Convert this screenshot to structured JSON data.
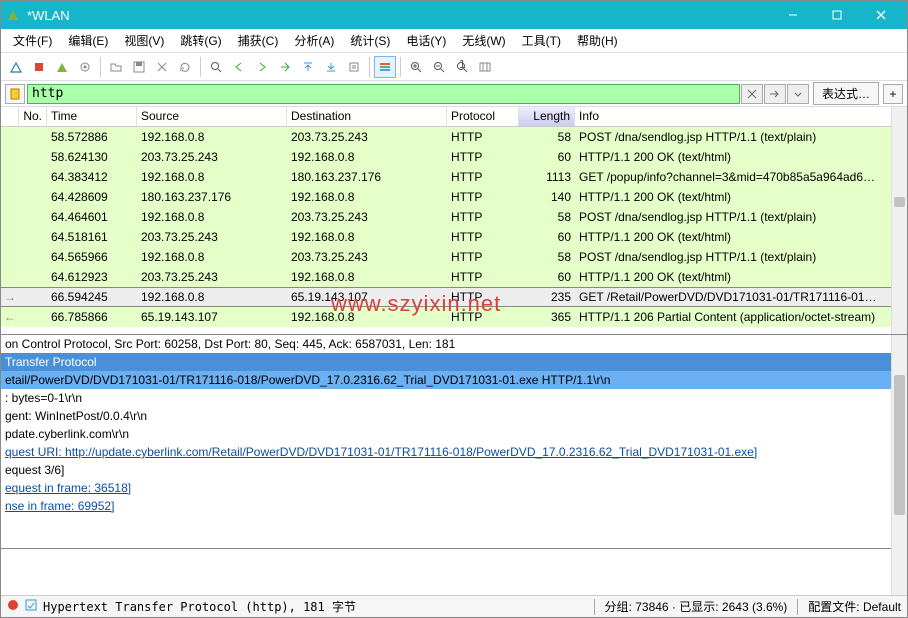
{
  "window": {
    "title": "*WLAN"
  },
  "menu": [
    "文件(F)",
    "编辑(E)",
    "视图(V)",
    "跳转(G)",
    "捕获(C)",
    "分析(A)",
    "统计(S)",
    "电话(Y)",
    "无线(W)",
    "工具(T)",
    "帮助(H)"
  ],
  "filter": {
    "value": "http",
    "expression_btn": "表达式…"
  },
  "columns": {
    "no": "No.",
    "time": "Time",
    "source": "Source",
    "dest": "Destination",
    "proto": "Protocol",
    "length": "Length",
    "info": "Info"
  },
  "packets": [
    {
      "arrow": "",
      "time": "58.572886",
      "src": "192.168.0.8",
      "dst": "203.73.25.243",
      "proto": "HTTP",
      "len": "58",
      "info": "POST /dna/sendlog.jsp HTTP/1.1  (text/plain)",
      "cls": "http"
    },
    {
      "arrow": "",
      "time": "58.624130",
      "src": "203.73.25.243",
      "dst": "192.168.0.8",
      "proto": "HTTP",
      "len": "60",
      "info": "HTTP/1.1 200 OK  (text/html)",
      "cls": "http"
    },
    {
      "arrow": "",
      "time": "64.383412",
      "src": "192.168.0.8",
      "dst": "180.163.237.176",
      "proto": "HTTP",
      "len": "1113",
      "info": "GET /popup/info?channel=3&mid=470b85a5a964ad6…",
      "cls": "http"
    },
    {
      "arrow": "",
      "time": "64.428609",
      "src": "180.163.237.176",
      "dst": "192.168.0.8",
      "proto": "HTTP",
      "len": "140",
      "info": "HTTP/1.1 200 OK  (text/html)",
      "cls": "http"
    },
    {
      "arrow": "",
      "time": "64.464601",
      "src": "192.168.0.8",
      "dst": "203.73.25.243",
      "proto": "HTTP",
      "len": "58",
      "info": "POST /dna/sendlog.jsp HTTP/1.1  (text/plain)",
      "cls": "http"
    },
    {
      "arrow": "",
      "time": "64.518161",
      "src": "203.73.25.243",
      "dst": "192.168.0.8",
      "proto": "HTTP",
      "len": "60",
      "info": "HTTP/1.1 200 OK  (text/html)",
      "cls": "http"
    },
    {
      "arrow": "",
      "time": "64.565966",
      "src": "192.168.0.8",
      "dst": "203.73.25.243",
      "proto": "HTTP",
      "len": "58",
      "info": "POST /dna/sendlog.jsp HTTP/1.1  (text/plain)",
      "cls": "http"
    },
    {
      "arrow": "",
      "time": "64.612923",
      "src": "203.73.25.243",
      "dst": "192.168.0.8",
      "proto": "HTTP",
      "len": "60",
      "info": "HTTP/1.1 200 OK  (text/html)",
      "cls": "http"
    },
    {
      "arrow": "→",
      "time": "66.594245",
      "src": "192.168.0.8",
      "dst": "65.19.143.107",
      "proto": "HTTP",
      "len": "235",
      "info": "GET /Retail/PowerDVD/DVD171031-01/TR171116-01…",
      "cls": "selected"
    },
    {
      "arrow": "←",
      "time": "66.785866",
      "src": "65.19.143.107",
      "dst": "192.168.0.8",
      "proto": "HTTP",
      "len": "365",
      "info": "HTTP/1.1 206 Partial Content  (application/octet-stream)",
      "cls": "http"
    }
  ],
  "details": [
    {
      "cls": "",
      "text": "on Control Protocol, Src Port: 60258, Dst Port: 80, Seq: 445, Ack: 6587031, Len: 181"
    },
    {
      "cls": "sel1",
      "text": "Transfer Protocol"
    },
    {
      "cls": "sel2",
      "text": "etail/PowerDVD/DVD171031-01/TR171116-018/PowerDVD_17.0.2316.62_Trial_DVD171031-01.exe HTTP/1.1\\r\\n"
    },
    {
      "cls": "",
      "text": ": bytes=0-1\\r\\n"
    },
    {
      "cls": "",
      "text": "gent: WinInetPost/0.0.4\\r\\n"
    },
    {
      "cls": "",
      "text": "pdate.cyberlink.com\\r\\n"
    },
    {
      "cls": "",
      "text": " "
    },
    {
      "cls": "link",
      "text": "quest URI: http://update.cyberlink.com/Retail/PowerDVD/DVD171031-01/TR171116-018/PowerDVD_17.0.2316.62_Trial_DVD171031-01.exe]"
    },
    {
      "cls": "",
      "text": "equest 3/6]"
    },
    {
      "cls": "link",
      "text": "equest in frame: 36518]"
    },
    {
      "cls": "link",
      "text": "nse in frame: 69952]"
    }
  ],
  "status": {
    "field": "Hypertext Transfer Protocol (http), 181 字节",
    "packets": "分组: 73846 · 已显示: 2643 (3.6%)",
    "profile": "配置文件: Default"
  },
  "watermark": "www.szyixin.net"
}
